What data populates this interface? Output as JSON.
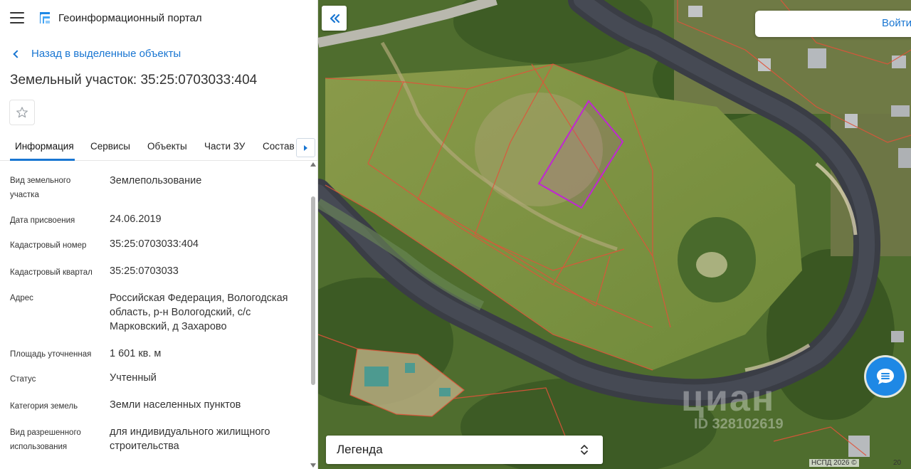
{
  "header": {
    "app_title": "Геоинформационный портал"
  },
  "nav": {
    "back_label": "Назад в выделенные объекты"
  },
  "object": {
    "title": "Земельный участок: 35:25:0703033:404"
  },
  "tabs": [
    {
      "label": "Информация",
      "active": true
    },
    {
      "label": "Сервисы",
      "active": false
    },
    {
      "label": "Объекты",
      "active": false
    },
    {
      "label": "Части ЗУ",
      "active": false
    },
    {
      "label": "Состав",
      "active": false
    }
  ],
  "info": [
    {
      "label": "Вид земельного участка",
      "value": "Землепользование"
    },
    {
      "label": "Дата присвоения",
      "value": "24.06.2019"
    },
    {
      "label": "Кадастровый номер",
      "value": "35:25:0703033:404"
    },
    {
      "label": "Кадастровый квартал",
      "value": "35:25:0703033"
    },
    {
      "label": "Адрес",
      "value": "Российская Федерация, Вологодская область, р-н Вологодский, с/с Марковский, д Захарово"
    },
    {
      "label": "Площадь уточненная",
      "value": "1 601 кв. м"
    },
    {
      "label": "Статус",
      "value": "Учтенный"
    },
    {
      "label": "Категория земель",
      "value": "Земли населенных пунктов"
    },
    {
      "label": "Вид разрешенного использования",
      "value": "для индивидуального жилищного строительства"
    }
  ],
  "map": {
    "login_label": "Войти",
    "legend_label": "Легенда",
    "copyright": "НСПД 2026 ©",
    "scale_label": "20",
    "watermark": "циан",
    "watermark_id": "ID 328102619",
    "parcel_color": "#e0533a",
    "selected_color": "#c026d3"
  },
  "colors": {
    "accent": "#1976d2",
    "chat": "#1e88e5"
  }
}
